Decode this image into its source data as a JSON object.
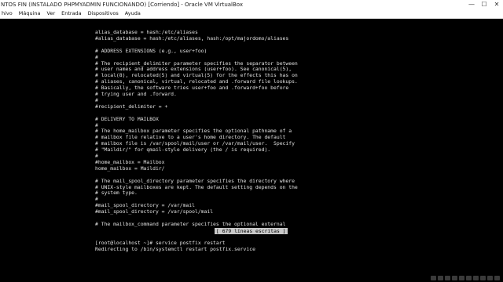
{
  "window": {
    "title": "NTOS FIN (INSTALADO PHPMYADMIN FUNCIONANDO) [Corriendo] - Oracle VM VirtualBox",
    "controls": [
      "—",
      "☐",
      "✕"
    ]
  },
  "menubar": [
    "hivo",
    "Máquina",
    "Ver",
    "Entrada",
    "Dispositivos",
    "Ayuda"
  ],
  "terminal": {
    "lines": [
      "alias_database = hash:/etc/aliases",
      "#alias_database = hash:/etc/aliases, hash:/opt/majordomo/aliases",
      "",
      "# ADDRESS EXTENSIONS (e.g., user+foo)",
      "#",
      "# The recipient_delimiter parameter specifies the separator between",
      "# user names and address extensions (user+foo). See canonical(5),",
      "# local(8), relocated(5) and virtual(5) for the effects this has on",
      "# aliases, canonical, virtual, relocated and .forward file lookups.",
      "# Basically, the software tries user+foo and .forward+foo before",
      "# trying user and .forward.",
      "#",
      "#recipient_delimiter = +",
      "",
      "# DELIVERY TO MAILBOX",
      "#",
      "# The home_mailbox parameter specifies the optional pathname of a",
      "# mailbox file relative to a user's home directory. The default",
      "# mailbox file is /var/spool/mail/user or /var/mail/user.  Specify",
      "# \"Maildir/\" for qmail-style delivery (the / is required).",
      "#",
      "#home_mailbox = Mailbox",
      "home_mailbox = Maildir/",
      "",
      "# The mail_spool_directory parameter specifies the directory where",
      "# UNIX-style mailboxes are kept. The default setting depends on the",
      "# system type.",
      "#",
      "#mail_spool_directory = /var/mail",
      "#mail_spool_directory = /var/spool/mail",
      "",
      "# The mailbox_command parameter specifies the optional external",
      "",
      "",
      "[root@localhost ~]# service postfix restart",
      "Redirecting to /bin/systemctl restart postfix.service"
    ],
    "status_message": "[ 679 líneas escritas ]"
  }
}
